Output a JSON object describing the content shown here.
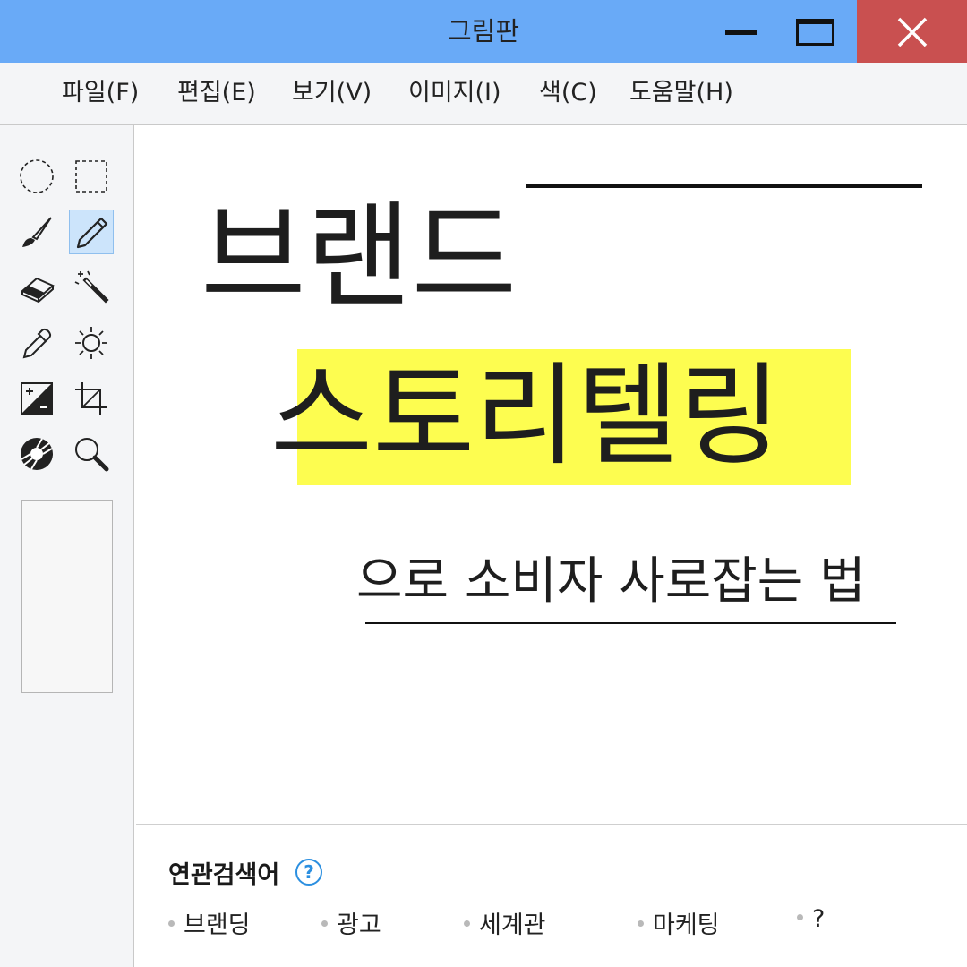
{
  "window": {
    "title": "그림판"
  },
  "menu": [
    "파일(F)",
    "편집(E)",
    "보기(V)",
    "이미지(I)",
    "색(C)",
    "도움말(H)"
  ],
  "tools": {
    "active": "pencil-tool"
  },
  "canvas": {
    "line1": "브랜드",
    "line2": "스토리텔링",
    "line3": "으로 소비자 사로잡는 법",
    "highlight_color": "#fdfd50"
  },
  "related": {
    "title": "연관검색어",
    "help": "?",
    "items": [
      "브랜딩",
      "광고",
      "세계관",
      "마케팅",
      "?"
    ]
  },
  "colors": {
    "titlebar": "#69aaf7",
    "close": "#c95050",
    "accent": "#2b8fe0"
  }
}
